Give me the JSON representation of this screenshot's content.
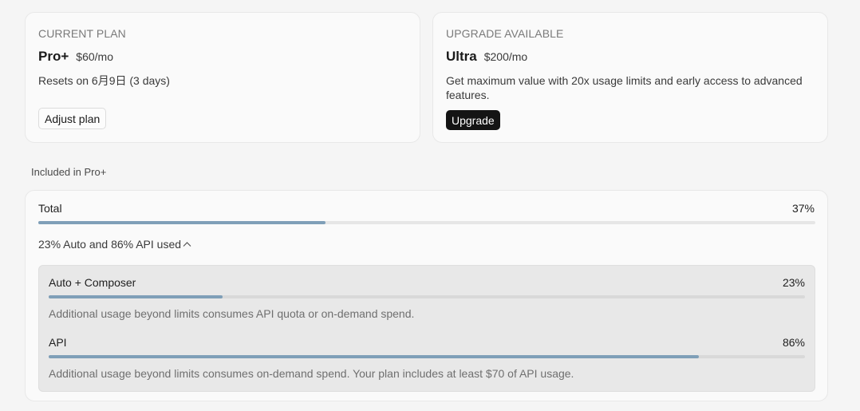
{
  "current_plan": {
    "eyebrow": "CURRENT PLAN",
    "name": "Pro+",
    "price": "$60/mo",
    "reset_text": "Resets on 6月9日 (3 days)",
    "button_label": "Adjust plan"
  },
  "upgrade": {
    "eyebrow": "UPGRADE AVAILABLE",
    "name": "Ultra",
    "price": "$200/mo",
    "description": "Get maximum value with 20x usage limits and early access to advanced features.",
    "button_label": "Upgrade"
  },
  "included_label": "Included in Pro+",
  "usage": {
    "total": {
      "label": "Total",
      "percent_text": "37%",
      "fraction": 0.37
    },
    "breakdown_toggle": "23% Auto and 86% API used",
    "toggle_icon": "chevron-up-icon",
    "items": [
      {
        "label": "Auto + Composer",
        "percent_text": "23%",
        "fraction": 0.23,
        "note": "Additional usage beyond limits consumes API quota or on-demand spend."
      },
      {
        "label": "API",
        "percent_text": "86%",
        "fraction": 0.86,
        "note": "Additional usage beyond limits consumes on-demand spend. Your plan includes at least $70 of API usage."
      }
    ]
  },
  "colors": {
    "bar_fill": "#7f9fb8",
    "bar_track": "#e6e6e6",
    "primary_button": "#141414"
  }
}
